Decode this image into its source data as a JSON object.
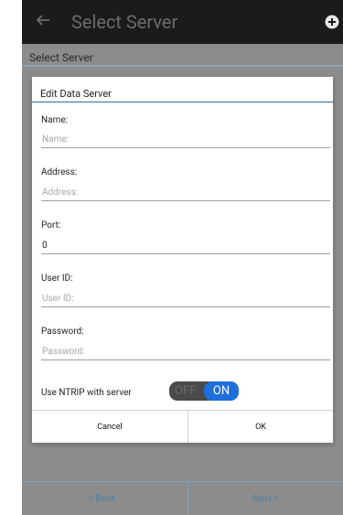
{
  "actionbar": {
    "title": "Select Server",
    "back_icon": "arrow-left-icon",
    "add_icon": "add-circle-icon"
  },
  "screen": {
    "section_label": "Select Server",
    "back_button": "< Back",
    "next_button": "Next >"
  },
  "dialog": {
    "title": "Edit Data Server",
    "fields": {
      "name": {
        "label": "Name:",
        "value": "",
        "placeholder": "Name:"
      },
      "address": {
        "label": "Address:",
        "value": "",
        "placeholder": "Address:"
      },
      "port": {
        "label": "Port:",
        "value": "0",
        "placeholder": ""
      },
      "user_id": {
        "label": "User ID:",
        "value": "",
        "placeholder": "User ID:"
      },
      "password": {
        "label": "Password:",
        "value": "",
        "placeholder": "Password:"
      }
    },
    "ntrip": {
      "label": "Use NTRIP with server",
      "off_text": "OFF",
      "on_text": "ON",
      "state": "on"
    },
    "cancel_label": "Cancel",
    "ok_label": "OK"
  },
  "colors": {
    "accent": "#1e6fd9",
    "title_line": "#2f6f9a",
    "actionbar": "#1b1b1b"
  }
}
